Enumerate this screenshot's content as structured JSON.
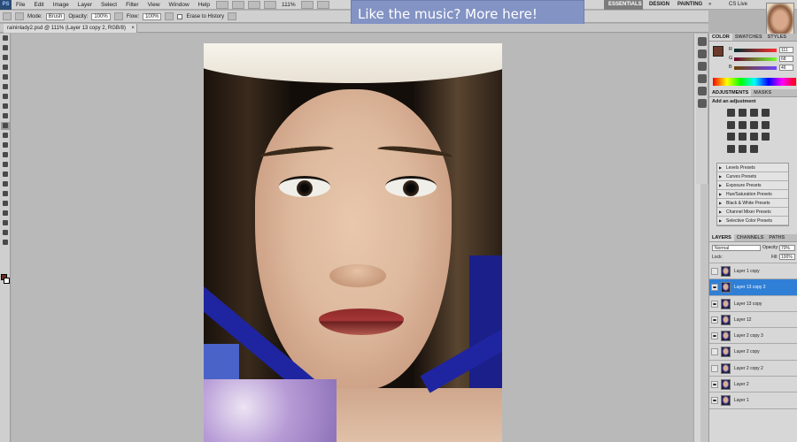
{
  "menubar": {
    "logo": "PS",
    "items": [
      "File",
      "Edit",
      "Image",
      "Layer",
      "Select",
      "Filter",
      "View",
      "Window",
      "Help"
    ],
    "zoom": "111%",
    "workspaces": {
      "essentials": "ESSENTIALS",
      "design": "DESIGN",
      "painting": "PAINTING",
      "more": "»",
      "cslive": "CS Live"
    }
  },
  "banner": {
    "text": "Like the music? More here!"
  },
  "options": {
    "mode_label": "Mode:",
    "mode_value": "Brush",
    "opacity_label": "Opacity:",
    "opacity_value": "100%",
    "flow_label": "Flow:",
    "flow_value": "100%",
    "erase_label": "Erase to History"
  },
  "document": {
    "tab": "raininlady2.psd @ 111% (Layer 13 copy 2, RGB/8)",
    "close": "×"
  },
  "color_panel": {
    "tabs": [
      "COLOR",
      "SWATCHES",
      "STYLES"
    ],
    "r": {
      "label": "R",
      "value": "111"
    },
    "g": {
      "label": "G",
      "value": "68"
    },
    "b": {
      "label": "B",
      "value": "46"
    },
    "foreground": "#6f442e",
    "background": "#ffffff"
  },
  "adjustments_panel": {
    "tabs": [
      "ADJUSTMENTS",
      "MASKS"
    ],
    "title": "Add an adjustment",
    "presets": [
      "Levels Presets",
      "Curves Presets",
      "Exposure Presets",
      "Hue/Saturation Presets",
      "Black & White Presets",
      "Channel Mixer Presets",
      "Selective Color Presets"
    ]
  },
  "layers_panel": {
    "tabs": [
      "LAYERS",
      "CHANNELS",
      "PATHS"
    ],
    "blend_mode": "Normal",
    "opacity_label": "Opacity:",
    "opacity_value": "70%",
    "lock_label": "Lock:",
    "fill_label": "Fill:",
    "fill_value": "100%",
    "layers": [
      {
        "name": "Layer 1 copy",
        "visible": false,
        "selected": false
      },
      {
        "name": "Layer 13 copy 2",
        "visible": true,
        "selected": true
      },
      {
        "name": "Layer 13 copy",
        "visible": true,
        "selected": false
      },
      {
        "name": "Layer 12",
        "visible": true,
        "selected": false
      },
      {
        "name": "Layer 2 copy 3",
        "visible": true,
        "selected": false
      },
      {
        "name": "Layer 2 copy",
        "visible": false,
        "selected": false
      },
      {
        "name": "Layer 2 copy 2",
        "visible": false,
        "selected": false
      },
      {
        "name": "Layer 2",
        "visible": true,
        "selected": false
      },
      {
        "name": "Layer 1",
        "visible": true,
        "selected": false
      }
    ]
  }
}
